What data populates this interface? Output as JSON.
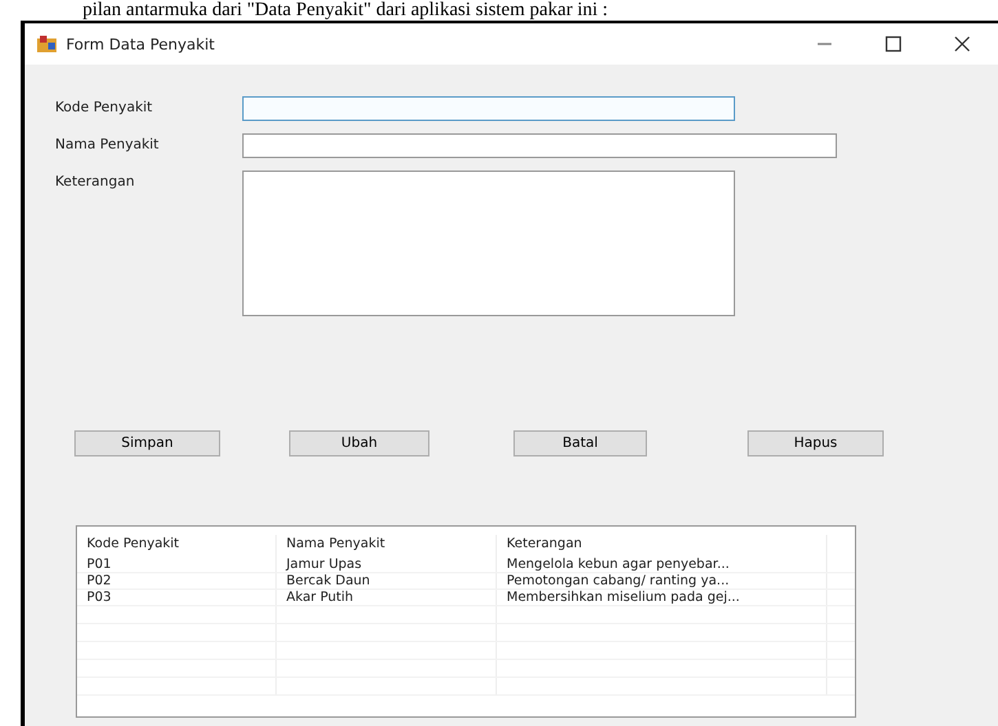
{
  "document_text": "pilan antarmuka dari \"Data Penyakit\" dari aplikasi sistem pakar ini :",
  "window": {
    "title": "Form Data Penyakit"
  },
  "fields": [
    {
      "label": "Kode Penyakit",
      "kind": "input",
      "focused": true
    },
    {
      "label": "Nama Penyakit",
      "kind": "input",
      "focused": false
    },
    {
      "label": "Keterangan",
      "kind": "textarea",
      "focused": false
    }
  ],
  "buttons": [
    "Simpan",
    "Ubah",
    "Batal",
    "Hapus"
  ],
  "table": {
    "columns": [
      "Kode Penyakit",
      "Nama Penyakit",
      "Keterangan"
    ],
    "rows": [
      [
        "P01",
        "Jamur Upas",
        "Mengelola kebun agar penyebar..."
      ],
      [
        "P02",
        "Bercak Daun",
        "Pemotongan cabang/ ranting ya..."
      ],
      [
        "P03",
        "Akar Putih",
        "Membersihkan miselium pada gej..."
      ]
    ]
  }
}
